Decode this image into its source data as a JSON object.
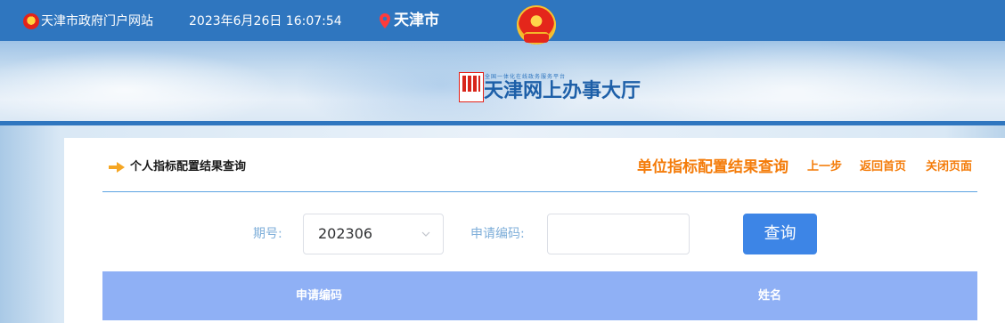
{
  "topbar": {
    "site_name": "天津市政府门户网站",
    "datetime": "2023年6月26日 16:07:54",
    "city": "天津市"
  },
  "banner": {
    "logo_tagline": "全国一体化在线政务服务平台",
    "logo_title": "天津网上办事大厅"
  },
  "page": {
    "title": "个人指标配置结果查询",
    "links": {
      "unit_query": "单位指标配置结果查询",
      "prev": "上一步",
      "home": "返回首页",
      "close": "关闭页面"
    }
  },
  "form": {
    "period_label": "期号:",
    "period_value": "202306",
    "code_label": "申请编码:",
    "code_value": "",
    "submit_label": "查询"
  },
  "table": {
    "columns": [
      "申请编码",
      "姓名"
    ]
  },
  "colors": {
    "topbar": "#2f76bf",
    "accent_orange": "#f47c0a",
    "button_blue": "#3d85e6",
    "table_header": "#8fb0f5"
  }
}
